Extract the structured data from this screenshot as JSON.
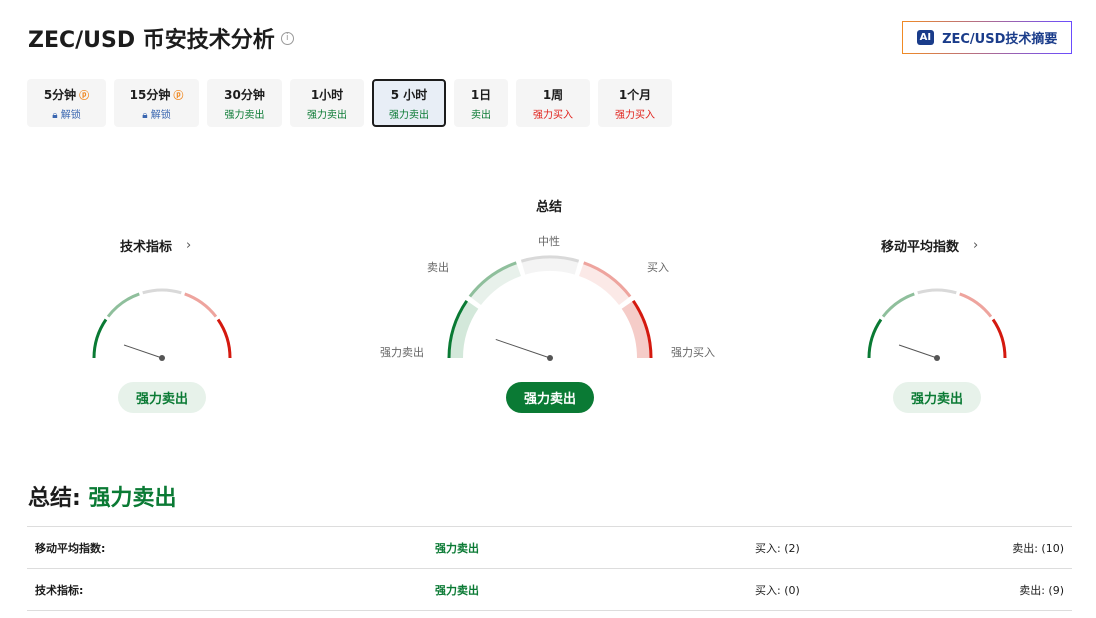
{
  "header": {
    "title": "ZEC/USD 币安技术分析",
    "ai_button": "ZEC/USD技术摘要",
    "ai_icon": "AI"
  },
  "tabs": [
    {
      "label": "5分钟",
      "status": "解锁",
      "kind": "unlock",
      "pro": true
    },
    {
      "label": "15分钟",
      "status": "解锁",
      "kind": "unlock",
      "pro": true
    },
    {
      "label": "30分钟",
      "status": "强力卖出",
      "kind": "sell"
    },
    {
      "label": "1小时",
      "status": "强力卖出",
      "kind": "sell"
    },
    {
      "label": "5 小时",
      "status": "强力卖出",
      "kind": "sell",
      "active": true
    },
    {
      "label": "1日",
      "status": "卖出",
      "kind": "sell"
    },
    {
      "label": "1周",
      "status": "强力买入",
      "kind": "buy"
    },
    {
      "label": "1个月",
      "status": "强力买入",
      "kind": "buy"
    }
  ],
  "gauges": {
    "technical": {
      "title": "技术指标",
      "result": "强力卖出",
      "needle": 0.1
    },
    "summary": {
      "title": "总结",
      "result": "强力卖出",
      "needle": 0.1,
      "labels": {
        "strong_sell": "强力卖出",
        "sell": "卖出",
        "neutral": "中性",
        "buy": "买入",
        "strong_buy": "强力买入"
      }
    },
    "ma": {
      "title": "移动平均指数",
      "result": "强力卖出",
      "needle": 0.1
    }
  },
  "summary": {
    "label": "总结:",
    "value": "强力卖出"
  },
  "table": [
    {
      "name": "移动平均指数:",
      "value": "强力卖出",
      "buy": "买入: (2)",
      "sell": "卖出: (10)"
    },
    {
      "name": "技术指标:",
      "value": "强力卖出",
      "buy": "买入: (0)",
      "sell": "卖出: (9)"
    }
  ],
  "colors": {
    "strong_sell": "#0a7a34",
    "sell": "#8fbf9c",
    "neutral": "#d9d9d9",
    "buy": "#eea49e",
    "strong_buy": "#d4190f"
  }
}
